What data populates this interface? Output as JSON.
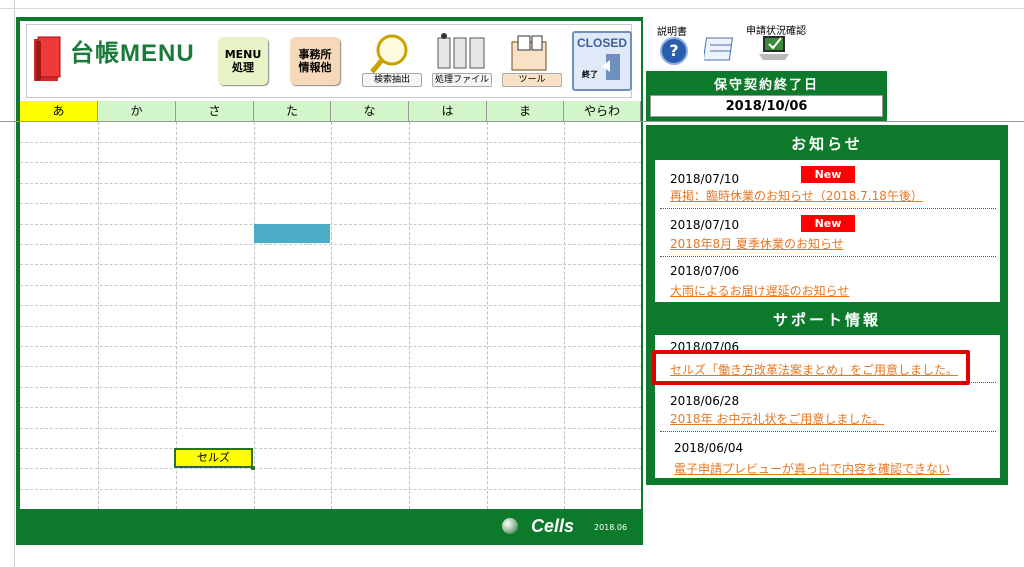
{
  "app": {
    "title": "台帳MENU"
  },
  "toolbar": {
    "menu_label": "MENU\n処理",
    "office_label": "事務所\n情報他",
    "search_label": "検索抽出",
    "process_label": "処理ファイル",
    "tool_label": "ツール",
    "closed_label": "CLOSED",
    "closed_sub": "終了"
  },
  "kana_tabs": [
    "あ",
    "か",
    "さ",
    "た",
    "な",
    "は",
    "ま",
    "やらわ"
  ],
  "active_tab": "あ",
  "grid": {
    "cell_item": "セルズ"
  },
  "footer": {
    "brand": "Cells",
    "version": "2018.06"
  },
  "top_links": {
    "manual": "説明書",
    "status": "申請状況確認"
  },
  "maintenance": {
    "title": "保守契約終了日",
    "date": "2018/10/06"
  },
  "news": {
    "title": "お知らせ",
    "badge": "New",
    "items": [
      {
        "date": "2018/07/10",
        "text": "再掲：臨時休業のお知らせ（2018.7.18午後）",
        "is_new": true
      },
      {
        "date": "2018/07/10",
        "text": "2018年8月 夏季休業のお知らせ",
        "is_new": true
      },
      {
        "date": "2018/07/06",
        "text": "大雨によるお届け遅延のお知らせ",
        "is_new": false
      }
    ]
  },
  "support": {
    "title": "サポート情報",
    "items": [
      {
        "date": "2018/07/06",
        "text": "セルズ「働き方改革法案まとめ」をご用意しました。"
      },
      {
        "date": "2018/06/28",
        "text": "2018年 お中元礼状をご用意しました。"
      },
      {
        "date": "2018/06/04",
        "text": "電子申請プレビューが真っ白で内容を確認できない"
      }
    ]
  },
  "colors": {
    "brand_green": "#0d7a2b",
    "link_orange": "#e87722",
    "new_red": "#ff0000",
    "highlight_red": "#e00000"
  }
}
